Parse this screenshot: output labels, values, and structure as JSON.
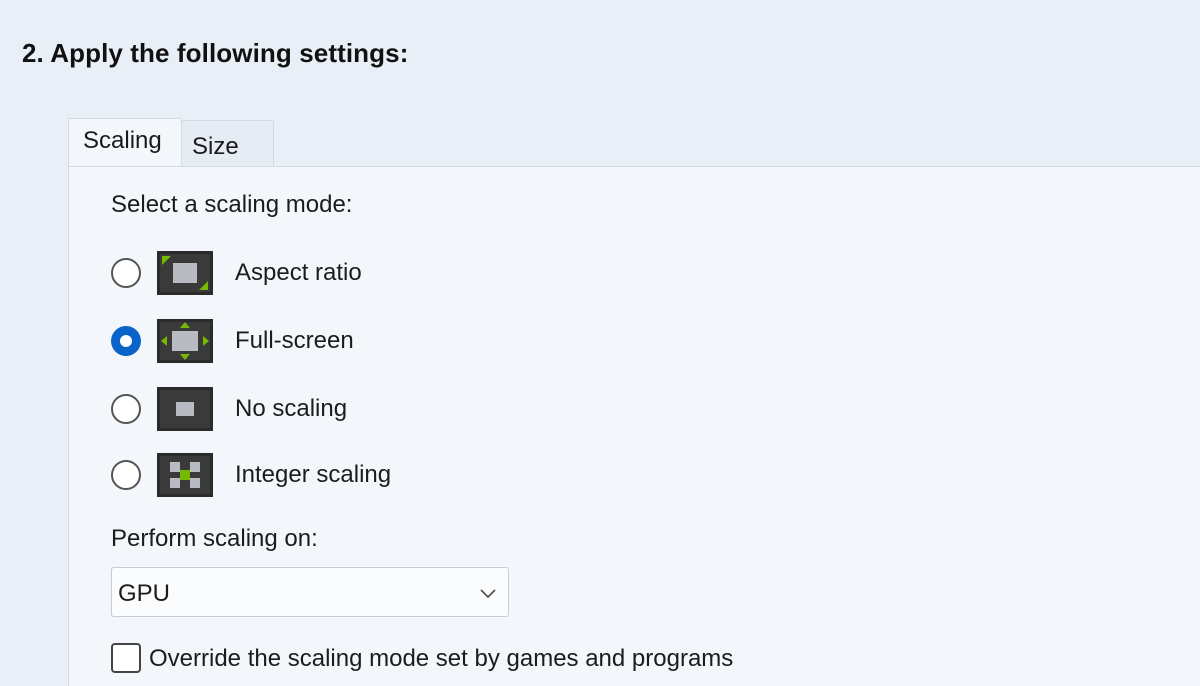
{
  "heading": "2. Apply the following settings:",
  "tabs": [
    {
      "label": "Scaling",
      "active": true
    },
    {
      "label": "Size",
      "active": false
    }
  ],
  "scaling": {
    "mode_label": "Select a scaling mode:",
    "modes": [
      {
        "label": "Aspect ratio",
        "icon": "aspect-ratio-icon",
        "selected": false
      },
      {
        "label": "Full-screen",
        "icon": "full-screen-icon",
        "selected": true
      },
      {
        "label": "No scaling",
        "icon": "no-scaling-icon",
        "selected": false
      },
      {
        "label": "Integer scaling",
        "icon": "integer-scaling-icon",
        "selected": false
      }
    ],
    "perform_label": "Perform scaling on:",
    "perform_value": "GPU",
    "override_label": "Override the scaling mode set by games and programs",
    "override_checked": false
  },
  "colors": {
    "background": "#e9eff7",
    "panel": "#f3f6fa",
    "radio_selected": "#0a63c9",
    "icon_dark": "#2b2b2b",
    "icon_gray": "#b8bcc2",
    "icon_green": "#76b900"
  }
}
